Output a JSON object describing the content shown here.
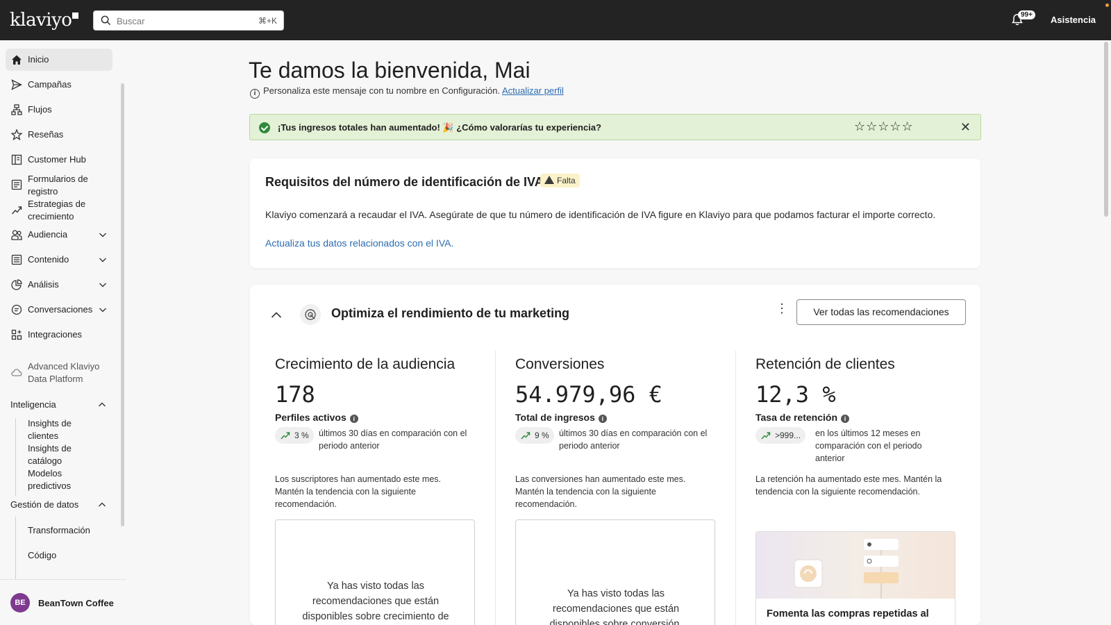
{
  "app": {
    "logo_text": "klaviyo"
  },
  "topbar": {
    "search_placeholder": "Buscar",
    "search_shortcut": "⌘+K",
    "notifications_badge": "99+",
    "help_label": "Asistencia"
  },
  "sidebar": {
    "items": [
      {
        "label": "Inicio"
      },
      {
        "label": "Campañas"
      },
      {
        "label": "Flujos"
      },
      {
        "label": "Reseñas"
      },
      {
        "label": "Customer Hub"
      },
      {
        "label": "Formularios de registro"
      },
      {
        "label": "Estrategias de crecimiento"
      },
      {
        "label": "Audiencia"
      },
      {
        "label": "Contenido"
      },
      {
        "label": "Análisis"
      },
      {
        "label": "Conversaciones"
      },
      {
        "label": "Integraciones"
      },
      {
        "label": "Advanced Klaviyo Data Platform"
      }
    ],
    "intelligence": {
      "label": "Inteligencia",
      "subitems": [
        "Insights de clientes",
        "Insights de catálogo",
        "Modelos predictivos"
      ]
    },
    "data_management": {
      "label": "Gestión de datos",
      "subitems": [
        "Transformación",
        "Código"
      ]
    },
    "account": {
      "initials": "BE",
      "name": "BeanTown Coffee"
    }
  },
  "main": {
    "title": "Te damos la bienvenida, Mai",
    "subnote": "Personaliza este mensaje con tu nombre en Configuración.",
    "subnote_link": "Actualizar perfil",
    "banner": {
      "message": "¡Tus ingresos totales han aumentado! 🎉 ¿Cómo valorarías tu experiencia?",
      "stars": "☆☆☆☆☆",
      "rating_max": 5
    },
    "vat": {
      "title": "Requisitos del número de identificación de IVA",
      "badge": "Falta",
      "body": "Klaviyo comenzará a recaudar el IVA. Asegúrate de que tu número de identificación de IVA figure en Klaviyo para que podamos facturar el importe correcto.",
      "link": "Actualiza tus datos relacionados con el IVA."
    },
    "optimize": {
      "title": "Optimiza el rendimiento de tu marketing",
      "all_recommendations_button": "Ver todas las recomendaciones",
      "columns": [
        {
          "heading": "Crecimiento de la audiencia",
          "value": "178",
          "metric": "Perfiles activos",
          "delta": "3 %",
          "comparison": "últimos 30 días en comparación con el periodo anterior",
          "description": "Los suscriptores han aumentado este mes. Mantén la tendencia con la siguiente recomendación.",
          "box_text": "Ya has visto todas las recomendaciones que están disponibles sobre crecimiento de"
        },
        {
          "heading": "Conversiones",
          "value": "54.979,96 €",
          "metric": "Total de ingresos",
          "delta": "9 %",
          "comparison": "últimos 30 días en comparación con el periodo anterior",
          "description": "Las conversiones han aumentado este mes. Mantén la tendencia con la siguiente recomendación.",
          "box_text": "Ya has visto todas las recomendaciones que están disponibles sobre conversión."
        },
        {
          "heading": "Retención de clientes",
          "value": "12,3 %",
          "metric": "Tasa de retención",
          "delta": ">999...",
          "comparison": "en los últimos 12 meses en comparación con el periodo anterior",
          "description": "La retención ha aumentado este mes. Mantén la tendencia con la siguiente recomendación.",
          "promo_title": "Fomenta las compras repetidas al"
        }
      ]
    }
  },
  "colors": {
    "topbar": "#232323",
    "link": "#2b6cb0",
    "banner_bg": "#e3f1d6",
    "success": "#2f8a3b",
    "warning_bg": "#fbf2c9",
    "avatar": "#7d3a8f"
  }
}
